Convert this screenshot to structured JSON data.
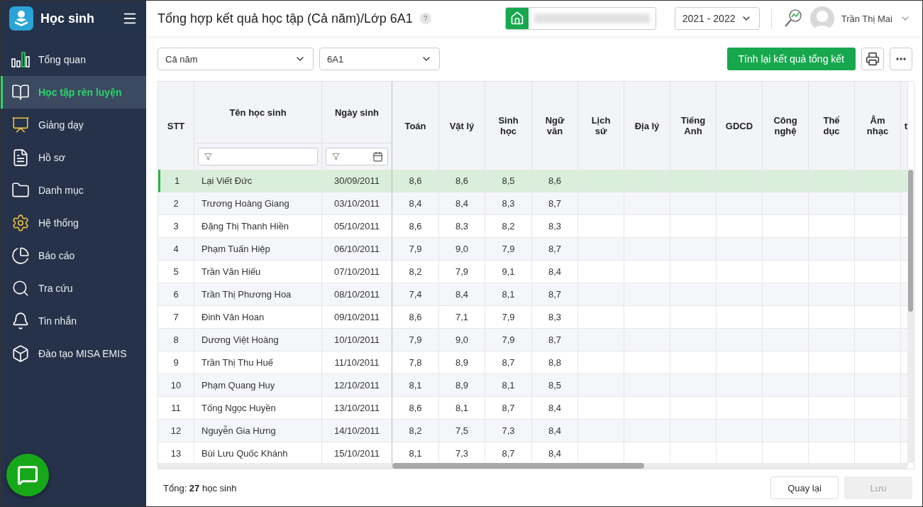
{
  "app": {
    "title": "Học sinh"
  },
  "sidebar": {
    "items": [
      {
        "label": "Tổng quan",
        "selected": false
      },
      {
        "label": "Học tập rèn luyện",
        "selected": true
      },
      {
        "label": "Giảng dạy",
        "selected": false
      },
      {
        "label": "Hồ sơ",
        "selected": false
      },
      {
        "label": "Danh mục",
        "selected": false
      },
      {
        "label": "Hệ thống",
        "selected": false
      },
      {
        "label": "Báo cáo",
        "selected": false
      },
      {
        "label": "Tra cứu",
        "selected": false
      },
      {
        "label": "Tin nhắn",
        "selected": false
      },
      {
        "label": "Đào tạo MISA EMIS",
        "selected": false
      }
    ]
  },
  "header": {
    "title": "Tổng hợp kết quả học tập (Cả năm)/Lớp 6A1",
    "help": "?",
    "school_year": "2021 - 2022",
    "user": "Trần Thị Mai"
  },
  "filters": [
    {
      "value": "Cả năm"
    },
    {
      "value": "6A1"
    }
  ],
  "actions": {
    "primary": "Tính lại kết quả tổng kết"
  },
  "table": {
    "columns": [
      "STT",
      "Tên học sinh",
      "Ngày sinh",
      "Toán",
      "Vật lý",
      "Sinh học",
      "Ngữ văn",
      "Lịch sử",
      "Địa lý",
      "Tiếng Anh",
      "GDCD",
      "Công nghệ",
      "Thể dục",
      "Âm nhạc",
      "t"
    ],
    "rows": [
      {
        "stt": "1",
        "name": "Lại Viết Đức",
        "dob": "30/09/2011",
        "scores": [
          "8,6",
          "8,6",
          "8,5",
          "8,6"
        ],
        "selected": true
      },
      {
        "stt": "2",
        "name": "Trương Hoàng Giang",
        "dob": "03/10/2011",
        "scores": [
          "8,4",
          "8,4",
          "8,3",
          "8,7"
        ],
        "selected": false
      },
      {
        "stt": "3",
        "name": "Đặng Thị Thanh Hiền",
        "dob": "05/10/2011",
        "scores": [
          "8,6",
          "8,3",
          "8,2",
          "8,3"
        ],
        "selected": false
      },
      {
        "stt": "4",
        "name": "Phạm Tuấn Hiệp",
        "dob": "06/10/2011",
        "scores": [
          "7,9",
          "9,0",
          "7,9",
          "8,7"
        ],
        "selected": false
      },
      {
        "stt": "5",
        "name": "Trần Văn Hiếu",
        "dob": "07/10/2011",
        "scores": [
          "8,2",
          "7,9",
          "9,1",
          "8,4"
        ],
        "selected": false
      },
      {
        "stt": "6",
        "name": "Trần Thị Phương Hoa",
        "dob": "08/10/2011",
        "scores": [
          "7,4",
          "8,4",
          "8,1",
          "8,7"
        ],
        "selected": false
      },
      {
        "stt": "7",
        "name": "Đinh Văn Hoan",
        "dob": "09/10/2011",
        "scores": [
          "8,6",
          "7,1",
          "7,9",
          "8,3"
        ],
        "selected": false
      },
      {
        "stt": "8",
        "name": "Dương Việt Hoàng",
        "dob": "10/10/2011",
        "scores": [
          "7,9",
          "9,0",
          "7,9",
          "8,7"
        ],
        "selected": false
      },
      {
        "stt": "9",
        "name": "Trần Thị Thu Huế",
        "dob": "11/10/2011",
        "scores": [
          "7,8",
          "8,9",
          "8,7",
          "8,8"
        ],
        "selected": false
      },
      {
        "stt": "10",
        "name": "Phạm Quang Huy",
        "dob": "12/10/2011",
        "scores": [
          "8,1",
          "8,9",
          "8,1",
          "8,5"
        ],
        "selected": false
      },
      {
        "stt": "11",
        "name": "Tống Ngọc Huyền",
        "dob": "13/10/2011",
        "scores": [
          "8,6",
          "8,1",
          "8,7",
          "8,4"
        ],
        "selected": false
      },
      {
        "stt": "12",
        "name": "Nguyễn Gia Hưng",
        "dob": "14/10/2011",
        "scores": [
          "8,2",
          "7,5",
          "7,3",
          "8,4"
        ],
        "selected": false
      },
      {
        "stt": "13",
        "name": "Bùi Lưu Quốc Khánh",
        "dob": "15/10/2011",
        "scores": [
          "8,1",
          "7,3",
          "8,7",
          "8,4"
        ],
        "selected": false
      }
    ]
  },
  "footer": {
    "total": "Tổng: **27** học sinh",
    "buttons": [
      {
        "label": "Quay lại",
        "disabled": false
      },
      {
        "label": "Lưu",
        "disabled": true
      }
    ]
  }
}
